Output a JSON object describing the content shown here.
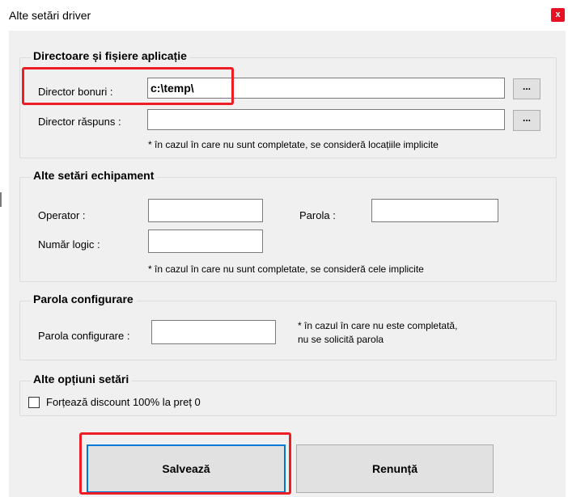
{
  "window": {
    "title": "Alte setări driver",
    "close_label": "x"
  },
  "groups": {
    "directories": {
      "title": "Directoare și fișiere aplicație",
      "receipts_label": "Director bonuri :",
      "receipts_value": "c:\\temp\\",
      "response_label": "Director răspuns :",
      "response_value": "",
      "browse_label": "...",
      "note": "* în cazul în care nu sunt completate, se consideră locațiile implicite"
    },
    "equipment": {
      "title": "Alte setări echipament",
      "operator_label": "Operator :",
      "operator_value": "",
      "password_label": "Parola :",
      "password_value": "",
      "logical_label": "Număr logic :",
      "logical_value": "",
      "note": "* în cazul în care nu sunt completate, se consideră cele implicite"
    },
    "config_password": {
      "title": "Parola configurare",
      "label": "Parola configurare :",
      "value": "",
      "note_line1": "* în cazul în care nu este completată,",
      "note_line2": "nu se solicită parola"
    },
    "options": {
      "title": "Alte opțiuni setări",
      "discount_label": "Forțează discount 100% la preț 0",
      "discount_checked": false
    }
  },
  "buttons": {
    "save": "Salvează",
    "cancel": "Renunță"
  },
  "colors": {
    "highlight": "#ee1c25",
    "focus": "#0078d7",
    "dialog_bg": "#f0f0f0"
  }
}
